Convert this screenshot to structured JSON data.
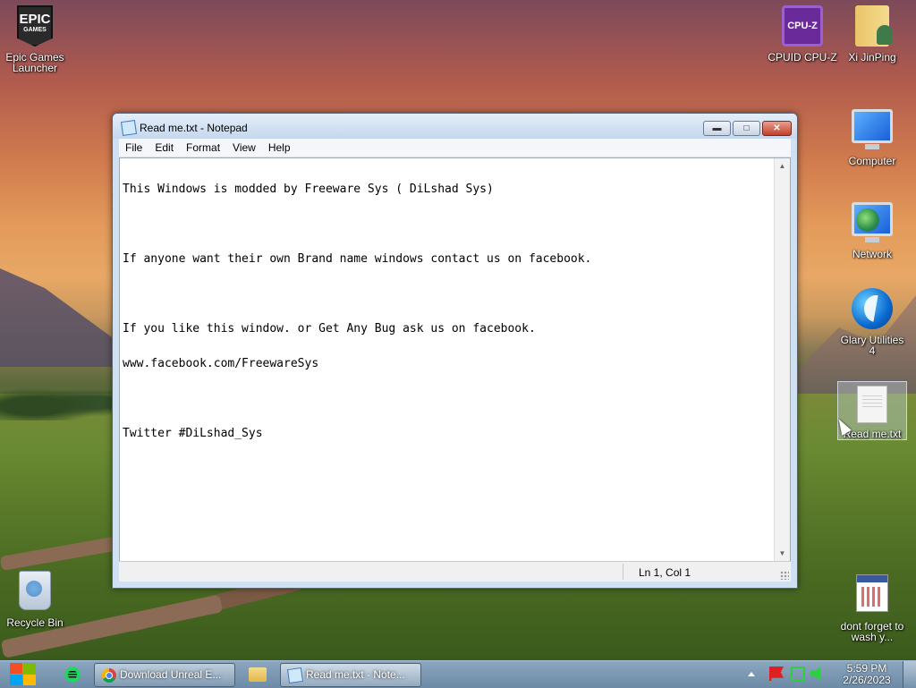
{
  "desktop_icons": {
    "epic": {
      "label": "Epic Games Launcher",
      "logo_text": "EPIC",
      "logo_sub": "GAMES"
    },
    "cpuz": {
      "label": "CPUID CPU-Z",
      "logo_text": "CPU-Z"
    },
    "xi": {
      "label": "Xi JinPing"
    },
    "computer": {
      "label": "Computer"
    },
    "network": {
      "label": "Network"
    },
    "glary": {
      "label": "Glary Utilities 4"
    },
    "readme": {
      "label": "Read me.txt"
    },
    "recycle": {
      "label": "Recycle Bin"
    },
    "dontforget": {
      "label": "dont forget to wash y..."
    }
  },
  "notepad": {
    "title": "Read me.txt - Notepad",
    "menu": [
      "File",
      "Edit",
      "Format",
      "View",
      "Help"
    ],
    "lines": [
      "This Windows is modded by Freeware Sys ( DiLshad Sys)",
      "",
      "If anyone want their own Brand name windows contact us on facebook.",
      "",
      "If you like this window. or Get Any Bug ask us on facebook.",
      "www.facebook.com/FreewareSys",
      "",
      "Twitter #DiLshad_Sys"
    ],
    "status_position": "Ln 1, Col 1"
  },
  "taskbar": {
    "tasks": [
      {
        "label": "Download Unreal E...",
        "icon": "chrome-icon"
      },
      {
        "label": "Read me.txt - Note...",
        "icon": "notepad-icon",
        "active": true
      }
    ],
    "clock_time": "5:59 PM",
    "clock_date": "2/26/2023"
  }
}
